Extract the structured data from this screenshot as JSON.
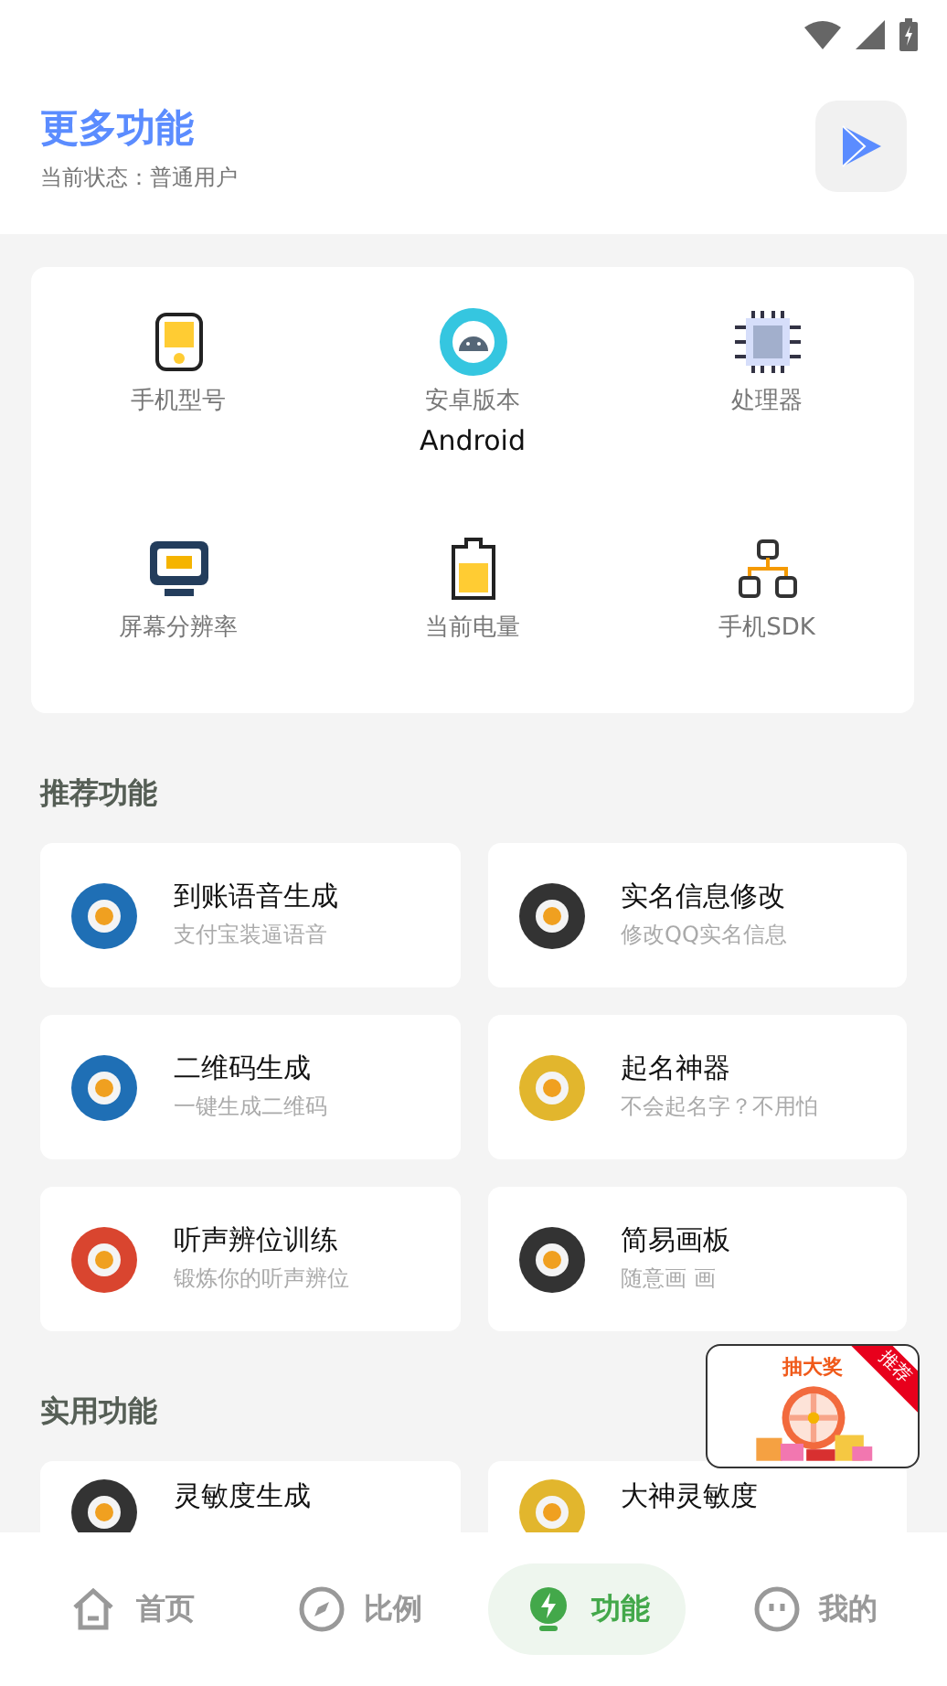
{
  "header": {
    "title": "更多功能",
    "status": "当前状态：普通用户"
  },
  "info_items": [
    {
      "label": "手机型号"
    },
    {
      "label": "安卓版本",
      "value": "Android"
    },
    {
      "label": "处理器"
    },
    {
      "label": "屏幕分辨率"
    },
    {
      "label": "当前电量"
    },
    {
      "label": "手机SDK"
    }
  ],
  "sections": [
    {
      "title": "推荐功能",
      "cards": [
        {
          "title": "到账语音生成",
          "subtitle": "支付宝装逼语音"
        },
        {
          "title": "实名信息修改",
          "subtitle": "修改QQ实名信息"
        },
        {
          "title": "二维码生成",
          "subtitle": "一键生成二维码"
        },
        {
          "title": "起名神器",
          "subtitle": "不会起名字？不用怕"
        },
        {
          "title": "听声辨位训练",
          "subtitle": "锻炼你的听声辨位"
        },
        {
          "title": "简易画板",
          "subtitle": "随意画 画"
        }
      ]
    },
    {
      "title": "实用功能",
      "cards": [
        {
          "title": "灵敏度生成"
        },
        {
          "title": "大神灵敏度"
        }
      ]
    }
  ],
  "promo": {
    "title": "抽大奖",
    "badge": "推荐"
  },
  "nav": [
    {
      "label": "首页",
      "selected": false
    },
    {
      "label": "比例",
      "selected": false
    },
    {
      "label": "功能",
      "selected": true
    },
    {
      "label": "我的",
      "selected": false
    }
  ]
}
